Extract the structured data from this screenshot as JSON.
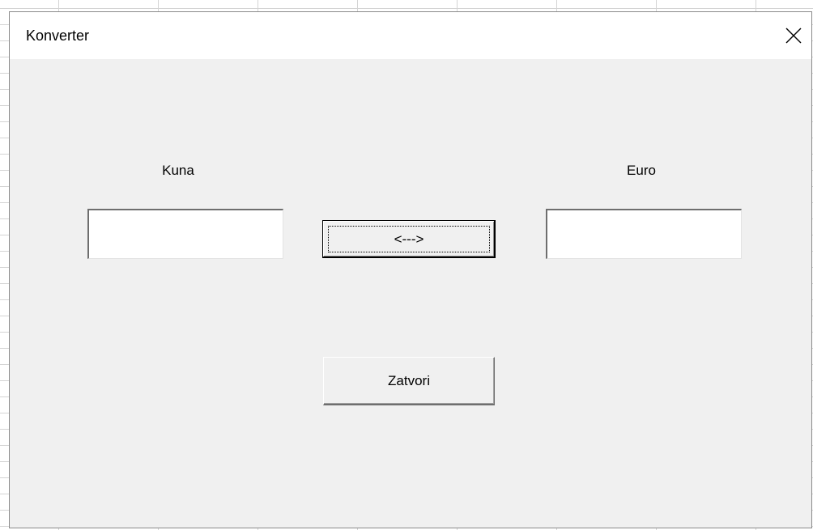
{
  "window": {
    "title": "Konverter",
    "close_icon": "close-icon"
  },
  "form": {
    "kuna_label": "Kuna",
    "euro_label": "Euro",
    "kuna_value": "",
    "euro_value": "",
    "swap_button_label": "<--->",
    "close_button_label": "Zatvori"
  },
  "colors": {
    "dialog_background": "#f0f0f0",
    "titlebar_background": "#ffffff",
    "input_background": "#ffffff"
  }
}
